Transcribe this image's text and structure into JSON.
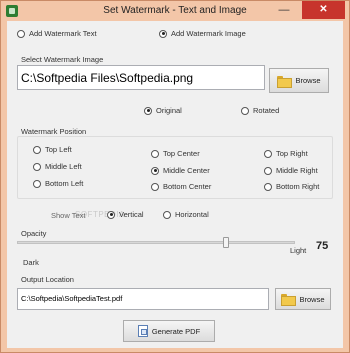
{
  "window": {
    "title": "Set Watermark  - Text and Image",
    "minimize_glyph": "—",
    "close_glyph": "✕",
    "accent_color": "#f3c6a8",
    "close_color": "#c7342c"
  },
  "watermark_type": {
    "options": [
      "Add Watermark Text",
      "Add Watermark Image"
    ],
    "selected": "Add Watermark Image"
  },
  "image": {
    "caption": "Select Watermark Image",
    "path": "C:\\Softpedia Files\\Softpedia.png",
    "browse_label": "Browse"
  },
  "orientation": {
    "options": [
      "Original",
      "Rotated"
    ],
    "selected": "Original"
  },
  "position": {
    "caption": "Watermark Position",
    "options": [
      "Top Left",
      "Top Center",
      "Top Right",
      "Middle Left",
      "Middle Center",
      "Middle Right",
      "Bottom Left",
      "Bottom Center",
      "Bottom Right"
    ],
    "selected": "Middle Center"
  },
  "show_text": {
    "caption": "Show Text",
    "options": [
      "Vertical",
      "Horizontal"
    ],
    "selected": "Vertical"
  },
  "opacity": {
    "caption": "Opacity",
    "min_label": "Dark",
    "max_label": "Light",
    "value": "75",
    "level": 0.75
  },
  "output": {
    "caption": "Output Location",
    "path": "C:\\Softpedia\\SoftpediaTest.pdf",
    "browse_label": "Browse"
  },
  "generate_label": "Generate PDF",
  "background_watermark": "SOFTPEDIA"
}
